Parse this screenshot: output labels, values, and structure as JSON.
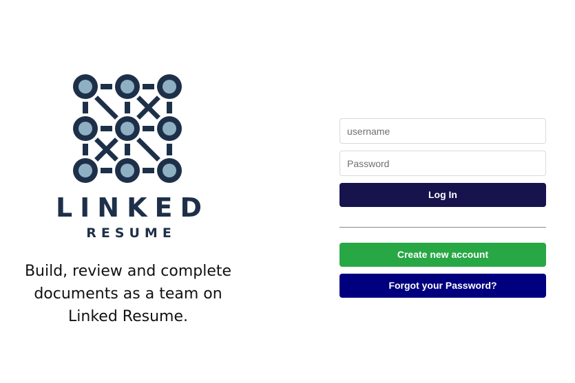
{
  "brand": {
    "name": "LINKED",
    "sub": "RESUME",
    "tagline_lines": [
      "Build, review and complete",
      "documents as a team on",
      "Linked Resume."
    ],
    "logo_dark": "#1e3049",
    "logo_light": "#8fb0c3"
  },
  "login_form": {
    "username_placeholder": "username",
    "password_placeholder": "Password",
    "login_label": "Log In",
    "create_account_label": "Create new account",
    "forgot_password_label": "Forgot your Password?"
  },
  "colors": {
    "login_button": "#16134d",
    "create_button": "#28a745",
    "forgot_button": "#00007f"
  }
}
